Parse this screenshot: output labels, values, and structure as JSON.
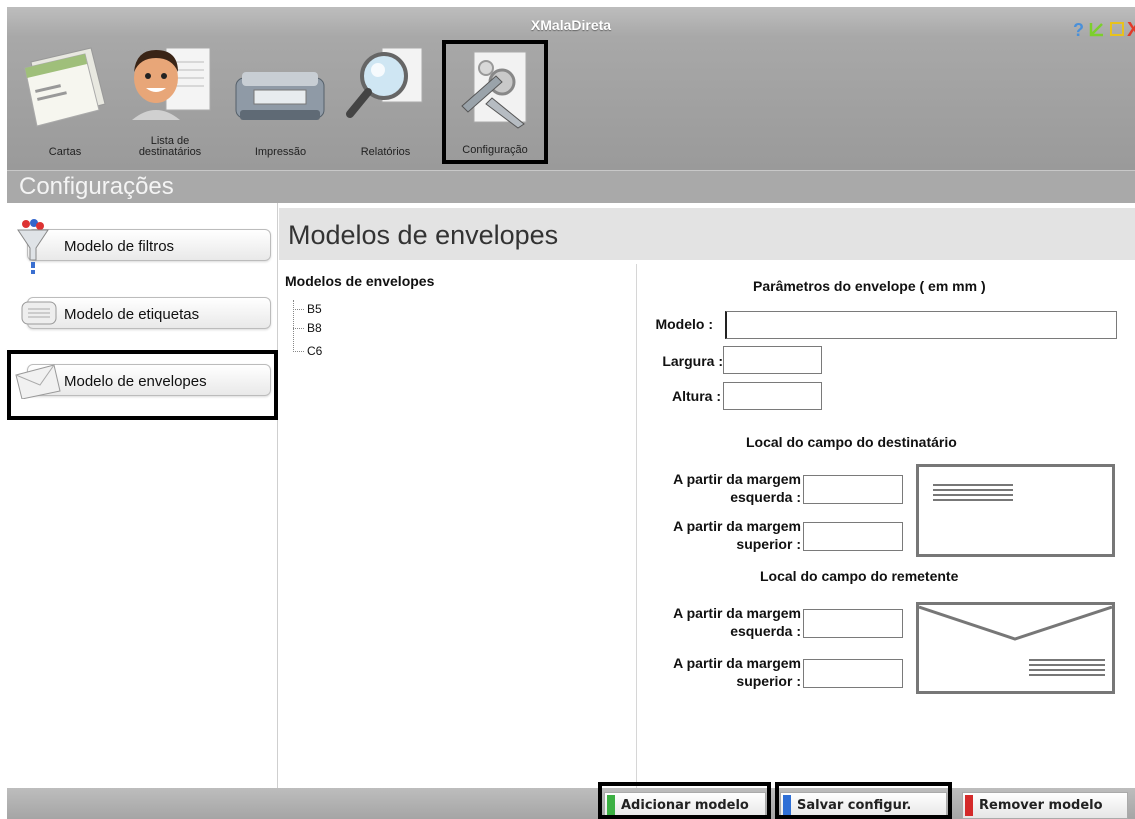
{
  "window": {
    "title": "XMalaDireta",
    "controls": [
      "help-icon",
      "minimize-icon",
      "maximize-icon",
      "close-icon"
    ],
    "help_symbol": "?",
    "close_symbol": "X"
  },
  "toolbar": {
    "items": [
      {
        "label": "Cartas",
        "icon": "letters-icon"
      },
      {
        "label": "Lista de destinatários",
        "icon": "recipients-icon"
      },
      {
        "label": "Impressão",
        "icon": "printer-icon"
      },
      {
        "label": "Relatórios",
        "icon": "magnifier-icon"
      },
      {
        "label": "Configuração",
        "icon": "settings-icon",
        "selected": true
      }
    ]
  },
  "section": {
    "title": "Configurações"
  },
  "sidebar": {
    "items": [
      {
        "label": "Modelo de filtros",
        "icon": "funnel-icon"
      },
      {
        "label": "Modelo de etiquetas",
        "icon": "label-icon"
      },
      {
        "label": "Modelo de envelopes",
        "icon": "envelope-icon",
        "selected": true
      }
    ]
  },
  "content": {
    "title": "Modelos de envelopes",
    "tree": {
      "title": "Modelos de envelopes",
      "items": [
        "B5",
        "B8",
        "C6"
      ]
    },
    "params": {
      "heading": "Parâmetros do envelope  ( em mm )",
      "modelo_label": "Modelo :",
      "modelo_value": "",
      "largura_label": "Largura :",
      "largura_value": "",
      "altura_label": "Altura :",
      "altura_value": "",
      "recipient_heading": "Local do campo do destinatário",
      "sender_heading": "Local do campo do remetente",
      "margin_left_label_1": "A partir da margem",
      "margin_left_label_2": "esquerda :",
      "margin_top_label_1": "A partir da margem",
      "margin_top_label_2": "superior :",
      "recipient_left_value": "",
      "recipient_top_value": "",
      "sender_left_value": "",
      "sender_top_value": ""
    }
  },
  "actions": {
    "add_label": "Adicionar modelo",
    "save_label": "Salvar configur.",
    "remove_label": "Remover modelo",
    "colors": {
      "add": "#3cb043",
      "save": "#2f6fd6",
      "remove": "#d42a2a"
    }
  }
}
